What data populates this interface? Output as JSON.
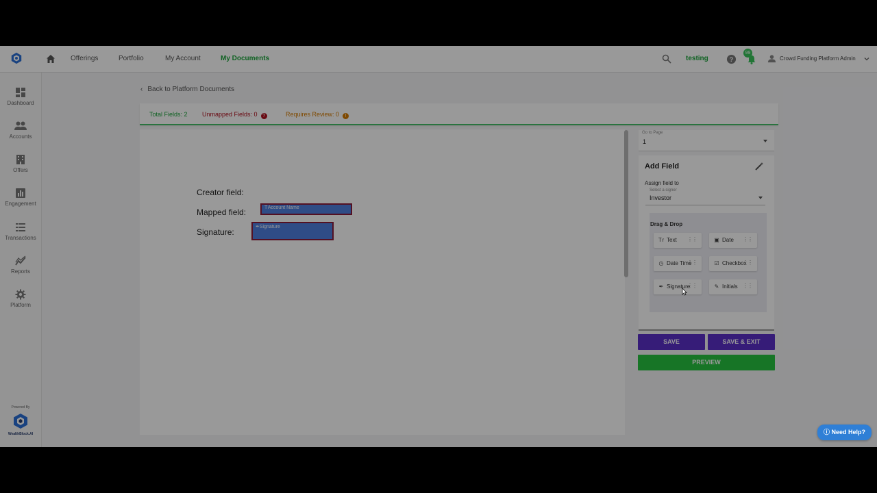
{
  "topnav": {
    "items": [
      "Offerings",
      "Portfolio",
      "My Account",
      "My Documents"
    ],
    "active": "My Documents",
    "environment": "testing",
    "notifications_count": "99",
    "user_name": "Crowd Funding Platform Admin"
  },
  "sidebar": {
    "items": [
      "Dashboard",
      "Accounts",
      "Offers",
      "Engagement",
      "Transactions",
      "Reports",
      "Platform"
    ],
    "powered_by": "Powered By",
    "powered_name": "WealthBlock.AI"
  },
  "main": {
    "back_link": "Back to Platform Documents",
    "stats": {
      "total": "Total Fields: 2",
      "unmapped": "Unmapped Fields: 0",
      "review": "Requires Review: 0"
    },
    "document": {
      "creator_label": "Creator field:",
      "mapped_label": "Mapped field:",
      "mapped_value": "Account Name",
      "signature_label": "Signature:",
      "signature_value": "Signature"
    }
  },
  "panel": {
    "page_select_label": "Go to Page",
    "page_value": "1",
    "title": "Add Field",
    "assign_label": "Assign field to",
    "signer_label": "Select a signer",
    "signer_value": "Investor",
    "dnd_title": "Drag & Drop",
    "fields": [
      {
        "label": "Text",
        "icon": "text-icon"
      },
      {
        "label": "Date",
        "icon": "calendar-icon"
      },
      {
        "label": "Date Time",
        "icon": "clock-icon"
      },
      {
        "label": "Checkbox",
        "icon": "checkbox-icon"
      },
      {
        "label": "Signature",
        "icon": "signature-icon"
      },
      {
        "label": "Initials",
        "icon": "pen-icon"
      }
    ],
    "save": "SAVE",
    "save_exit": "SAVE & EXIT",
    "preview": "PREVIEW"
  },
  "need_help": "Need Help?",
  "colors": {
    "accent_green": "#1aa33a",
    "button_purple": "#5a2fc9",
    "preview_green": "#27c440",
    "unmapped_red": "#b0101e",
    "review_orange": "#d47a00",
    "field_blue": "#4f7fe0"
  }
}
